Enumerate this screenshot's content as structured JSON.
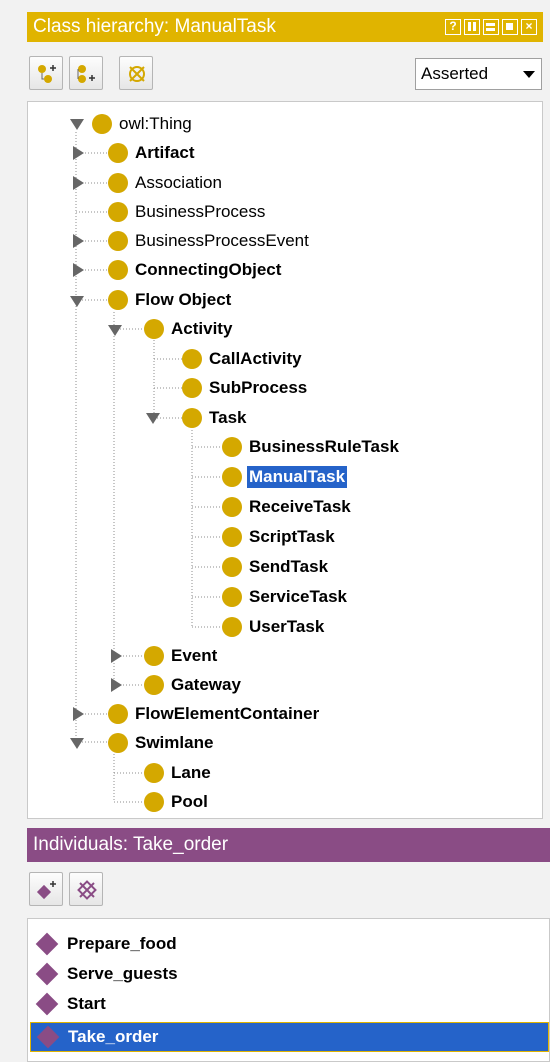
{
  "class_panel": {
    "title": "Class hierarchy: ManualTask",
    "header_icons": [
      "help-icon",
      "columns-icon",
      "rows-icon",
      "maximize-icon",
      "close-icon"
    ],
    "toolbar": {
      "buttons": [
        "add-subclass-icon",
        "add-sibling-class-icon",
        "delete-class-icon"
      ],
      "view_mode": "Asserted"
    },
    "tree": [
      {
        "label": "owl:Thing",
        "bold": false
      },
      {
        "label": "Artifact",
        "bold": true
      },
      {
        "label": "Association",
        "bold": false
      },
      {
        "label": "BusinessProcess",
        "bold": false
      },
      {
        "label": "BusinessProcessEvent",
        "bold": false
      },
      {
        "label": "ConnectingObject",
        "bold": true
      },
      {
        "label": "Flow Object",
        "bold": true
      },
      {
        "label": "Activity",
        "bold": true
      },
      {
        "label": "CallActivity",
        "bold": true
      },
      {
        "label": "SubProcess",
        "bold": true
      },
      {
        "label": "Task",
        "bold": true
      },
      {
        "label": "BusinessRuleTask",
        "bold": true
      },
      {
        "label": "ManualTask",
        "bold": true,
        "selected": true
      },
      {
        "label": "ReceiveTask",
        "bold": true
      },
      {
        "label": "ScriptTask",
        "bold": true
      },
      {
        "label": "SendTask",
        "bold": true
      },
      {
        "label": "ServiceTask",
        "bold": true
      },
      {
        "label": "UserTask",
        "bold": true
      },
      {
        "label": "Event",
        "bold": true
      },
      {
        "label": "Gateway",
        "bold": true
      },
      {
        "label": "FlowElementContainer",
        "bold": true
      },
      {
        "label": "Swimlane",
        "bold": true
      },
      {
        "label": "Lane",
        "bold": true
      },
      {
        "label": "Pool",
        "bold": true
      }
    ]
  },
  "individuals_panel": {
    "title": "Individuals: Take_order",
    "toolbar": {
      "buttons": [
        "add-individual-icon",
        "delete-individual-icon"
      ]
    },
    "items": [
      {
        "label": "Prepare_food"
      },
      {
        "label": "Serve_guests"
      },
      {
        "label": "Start"
      },
      {
        "label": "Take_order",
        "selected": true
      }
    ]
  },
  "colors": {
    "class_header": "#e0b400",
    "class_dot": "#d4a800",
    "individuals_header": "#8a4c85",
    "selection": "#2563c9"
  }
}
